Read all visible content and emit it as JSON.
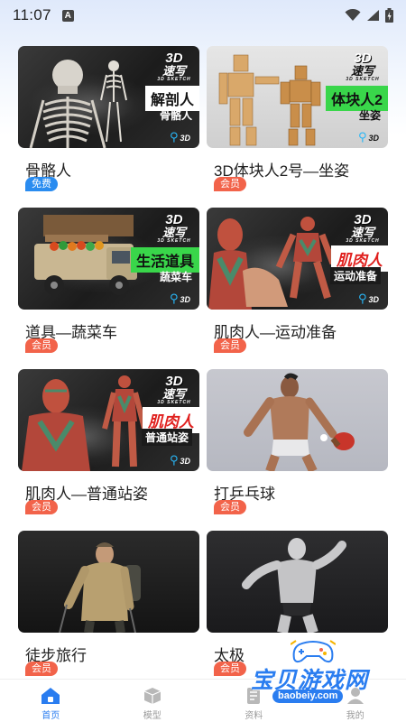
{
  "status_bar": {
    "time": "11:07",
    "notification_badge": "A",
    "icons": [
      "wifi-icon",
      "signal-icon",
      "battery-charging-icon"
    ]
  },
  "cards": [
    {
      "title": "骨骼人",
      "tag": "免费",
      "tag_type": "free",
      "thumb_brand": "3D",
      "thumb_brand_sub": "速写",
      "thumb_brand_en": "3D SKETCH",
      "thumb_label": "解剖人",
      "thumb_sublabel": "骨骼人"
    },
    {
      "title": "3D体块人2号—坐姿",
      "tag": "会员",
      "tag_type": "vip",
      "thumb_brand": "3D",
      "thumb_brand_sub": "速写",
      "thumb_brand_en": "3D SKETCH",
      "thumb_label": "体块人2",
      "thumb_sublabel": "坐姿"
    },
    {
      "title": "道具—蔬菜车",
      "tag": "会员",
      "tag_type": "vip",
      "thumb_brand": "3D",
      "thumb_brand_sub": "速写",
      "thumb_brand_en": "3D SKETCH",
      "thumb_label": "生活道具",
      "thumb_sublabel": "蔬菜车"
    },
    {
      "title": "肌肉人—运动准备",
      "tag": "会员",
      "tag_type": "vip",
      "thumb_brand": "3D",
      "thumb_brand_sub": "速写",
      "thumb_brand_en": "3D SKETCH",
      "thumb_label": "肌肉人",
      "thumb_sublabel": "运动准备"
    },
    {
      "title": "肌肉人—普通站姿",
      "tag": "会员",
      "tag_type": "vip",
      "thumb_brand": "3D",
      "thumb_brand_sub": "速写",
      "thumb_brand_en": "3D SKETCH",
      "thumb_label": "肌肉人",
      "thumb_sublabel": "普通站姿"
    },
    {
      "title": "打乒乓球",
      "tag": "会员",
      "tag_type": "vip"
    },
    {
      "title": "徒步旅行",
      "tag": "会员",
      "tag_type": "vip"
    },
    {
      "title": "太极",
      "tag": "会员",
      "tag_type": "vip"
    }
  ],
  "bottom_nav": [
    {
      "label": "首页",
      "icon": "home-icon",
      "active": true
    },
    {
      "label": "模型",
      "icon": "cube-icon",
      "active": false
    },
    {
      "label": "资料",
      "icon": "document-icon",
      "active": false
    },
    {
      "label": "我的",
      "icon": "profile-icon",
      "active": false
    }
  ],
  "watermark": {
    "text": "宝贝游戏网",
    "url": "baobeiy.com"
  },
  "colors": {
    "accent": "#2a7df0",
    "free_tag": "#2a8cf0",
    "vip_tag": "#f2634a"
  }
}
